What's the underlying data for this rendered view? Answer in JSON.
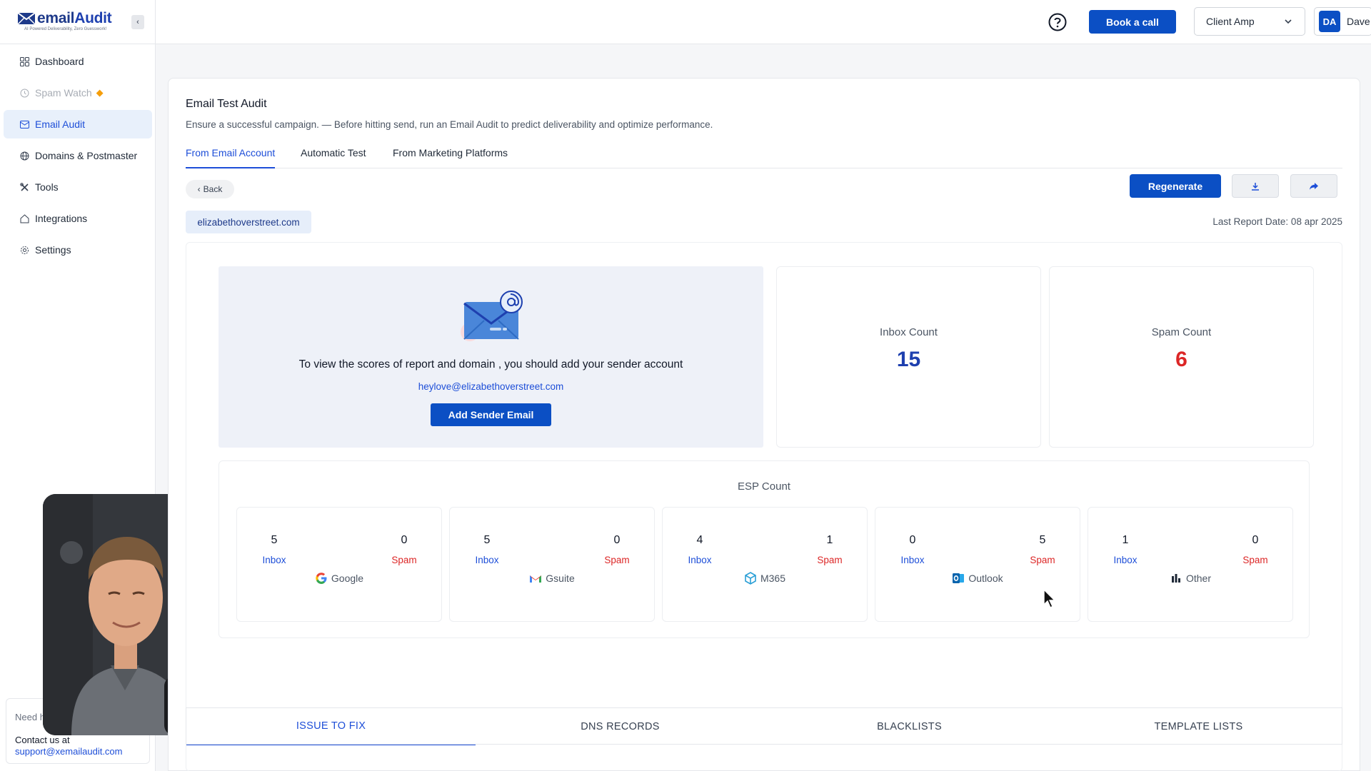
{
  "brand": {
    "name_prefix": "email",
    "name_suffix": "Audit",
    "tagline": "AI Powered Deliverability, Zero Guesswork!"
  },
  "sidebar": {
    "items": [
      {
        "label": "Dashboard",
        "icon": "grid-icon"
      },
      {
        "label": "Spam Watch",
        "icon": "clock-icon",
        "state": "disabled"
      },
      {
        "label": "Email Audit",
        "icon": "email-audit-icon",
        "state": "active"
      },
      {
        "label": "Domains & Postmaster",
        "icon": "globe-icon"
      },
      {
        "label": "Tools",
        "icon": "tools-icon"
      },
      {
        "label": "Integrations",
        "icon": "integrations-icon"
      },
      {
        "label": "Settings",
        "icon": "gear-icon"
      }
    ],
    "help": {
      "need": "Need h",
      "contact": "Contact us at",
      "email": "support@xemailaudit.com"
    }
  },
  "topbar": {
    "book_call": "Book a call",
    "client": "Client Amp",
    "user_initials": "DA",
    "user_name": "Dave"
  },
  "page": {
    "title": "Email Test Audit",
    "subtitle": "Ensure a successful campaign. — Before hitting send, run an Email Audit to predict deliverability and optimize performance.",
    "tabs": [
      "From Email Account",
      "Automatic Test",
      "From Marketing Platforms"
    ],
    "active_tab": 0,
    "back": "Back",
    "domain": "elizabethoverstreet.com",
    "regenerate": "Regenerate",
    "last_report": "Last Report Date: 08 apr 2025"
  },
  "sender": {
    "message": "To view the scores of report and domain , you should add your sender account",
    "email": "heylove@elizabethoverstreet.com",
    "button": "Add Sender Email"
  },
  "counts": {
    "inbox": {
      "label": "Inbox Count",
      "value": "15",
      "color": "#1e40af"
    },
    "spam": {
      "label": "Spam Count",
      "value": "6",
      "color": "#dc2626"
    }
  },
  "esp": {
    "title": "ESP Count",
    "inbox_label": "Inbox",
    "spam_label": "Spam",
    "providers": [
      {
        "name": "Google",
        "inbox": "5",
        "spam": "0",
        "icon": "google-icon"
      },
      {
        "name": "Gsuite",
        "inbox": "5",
        "spam": "0",
        "icon": "gmail-icon"
      },
      {
        "name": "M365",
        "inbox": "4",
        "spam": "1",
        "icon": "m365-icon"
      },
      {
        "name": "Outlook",
        "inbox": "0",
        "spam": "5",
        "icon": "outlook-icon"
      },
      {
        "name": "Other",
        "inbox": "1",
        "spam": "0",
        "icon": "bar-chart-icon"
      }
    ]
  },
  "bottom_tabs": [
    "ISSUE TO FIX",
    "DNS RECORDS",
    "BLACKLISTS",
    "TEMPLATE LISTS"
  ],
  "colors": {
    "primary": "#0b4fc4",
    "accent_blue": "#1d4ed8",
    "spam_red": "#dc2626"
  }
}
